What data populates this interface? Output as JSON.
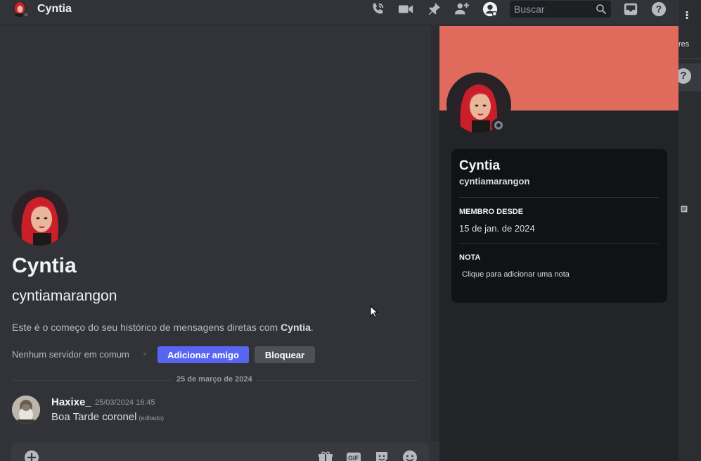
{
  "header": {
    "title": "Cyntia",
    "icons": [
      "phone-call-icon",
      "video-icon",
      "pin-icon",
      "add-member-icon",
      "profile-icon",
      "inbox-icon",
      "help-icon"
    ],
    "search_placeholder": "Buscar"
  },
  "side_strip": {
    "label": "res"
  },
  "intro": {
    "display_name": "Cyntia",
    "username": "cyntiamarangon",
    "text_prefix": "Este é o começo do seu histórico de mensagens diretas com ",
    "text_name": "Cyntia",
    "text_suffix": ".",
    "mutual_servers": "Nenhum servidor em comum",
    "add_friend_label": "Adicionar amigo",
    "block_label": "Bloquear"
  },
  "messages": {
    "date_divider": "25 de março de 2024",
    "items": [
      {
        "author": "Haxixe_",
        "timestamp": "25/03/2024 16:45",
        "text": "Boa Tarde coronel",
        "edited": "(editado)"
      }
    ]
  },
  "composer": {
    "icons": [
      "add-attachment-icon",
      "gift-icon",
      "gif-icon",
      "sticker-icon",
      "emoji-icon"
    ],
    "gif_label": "GIF"
  },
  "profile": {
    "banner_color": "#e06a5c",
    "display_name": "Cyntia",
    "username": "cyntiamarangon",
    "member_since_heading": "MEMBRO DESDE",
    "member_since": "15 de jan. de 2024",
    "note_heading": "NOTA",
    "note_placeholder": "Clique para adicionar uma nota"
  },
  "colors": {
    "accent": "#5865f2",
    "background": "#313338",
    "panel": "#232428"
  }
}
